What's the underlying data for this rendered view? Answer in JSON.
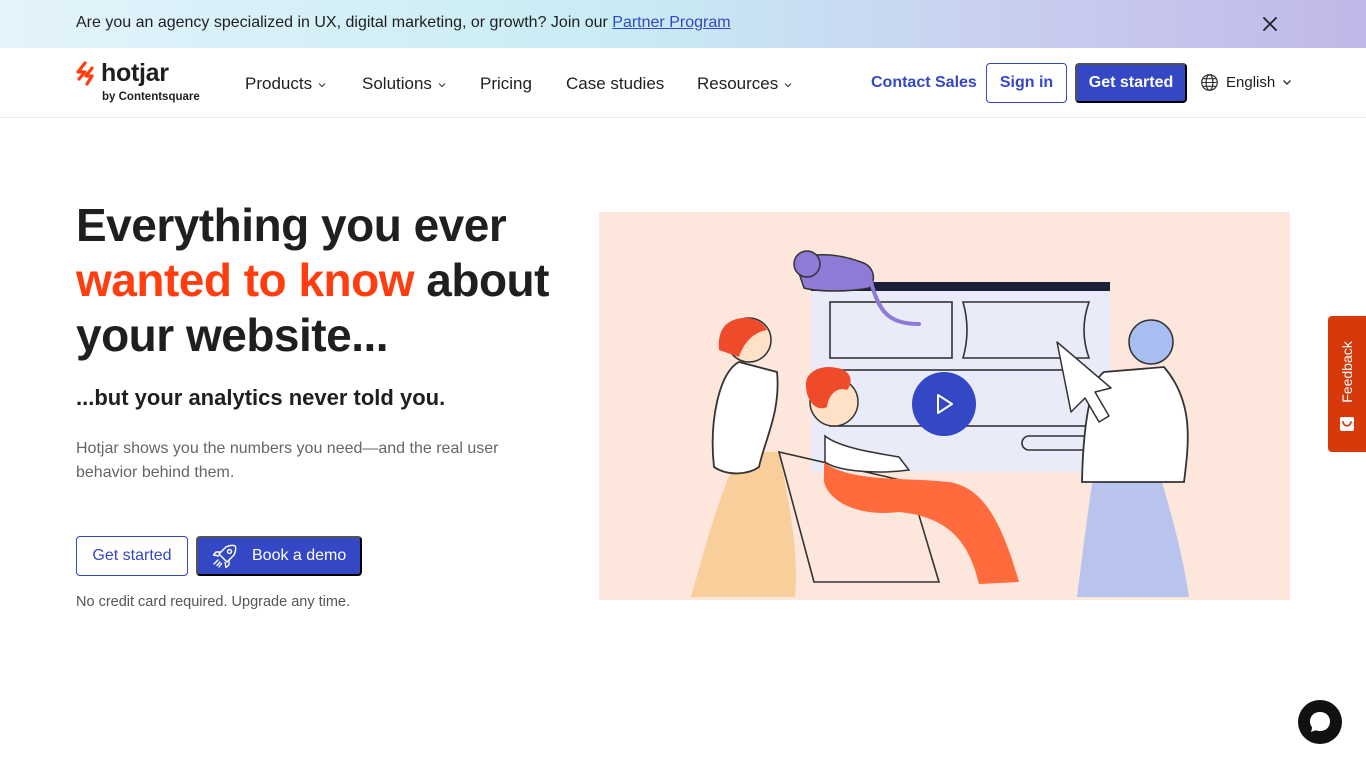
{
  "banner": {
    "text": "Are you an agency specialized in UX, digital marketing, or growth? Join our ",
    "link": "Partner Program",
    "close_icon": "close-icon"
  },
  "header": {
    "logo_word": "hotjar",
    "logo_sub": "by Contentsquare",
    "nav": {
      "products": "Products",
      "solutions": "Solutions",
      "pricing": "Pricing",
      "case_studies": "Case studies",
      "resources": "Resources"
    },
    "contact_sales": "Contact Sales",
    "sign_in": "Sign in",
    "get_started": "Get started",
    "language": "English",
    "language_icon": "globe-icon"
  },
  "hero": {
    "title_part1": "Everything you ever ",
    "title_accent": "wanted to know",
    "title_part2": " about your website...",
    "subtitle": "...but your analytics never told you.",
    "description": "Hotjar shows you the numbers you need—and the real user behavior behind them.",
    "cta_get_started": "Get started",
    "cta_book_demo": "Book a demo",
    "note": "No credit card required. Upgrade any time."
  },
  "feedback": {
    "label": "Feedback"
  },
  "chat": {
    "icon": "chat-icon"
  },
  "colors": {
    "brand_blue": "#3447c4",
    "accent_orange": "#ff3d0f",
    "feedback_red": "#d63a0b",
    "illustration_bg": "#fde7dd"
  }
}
